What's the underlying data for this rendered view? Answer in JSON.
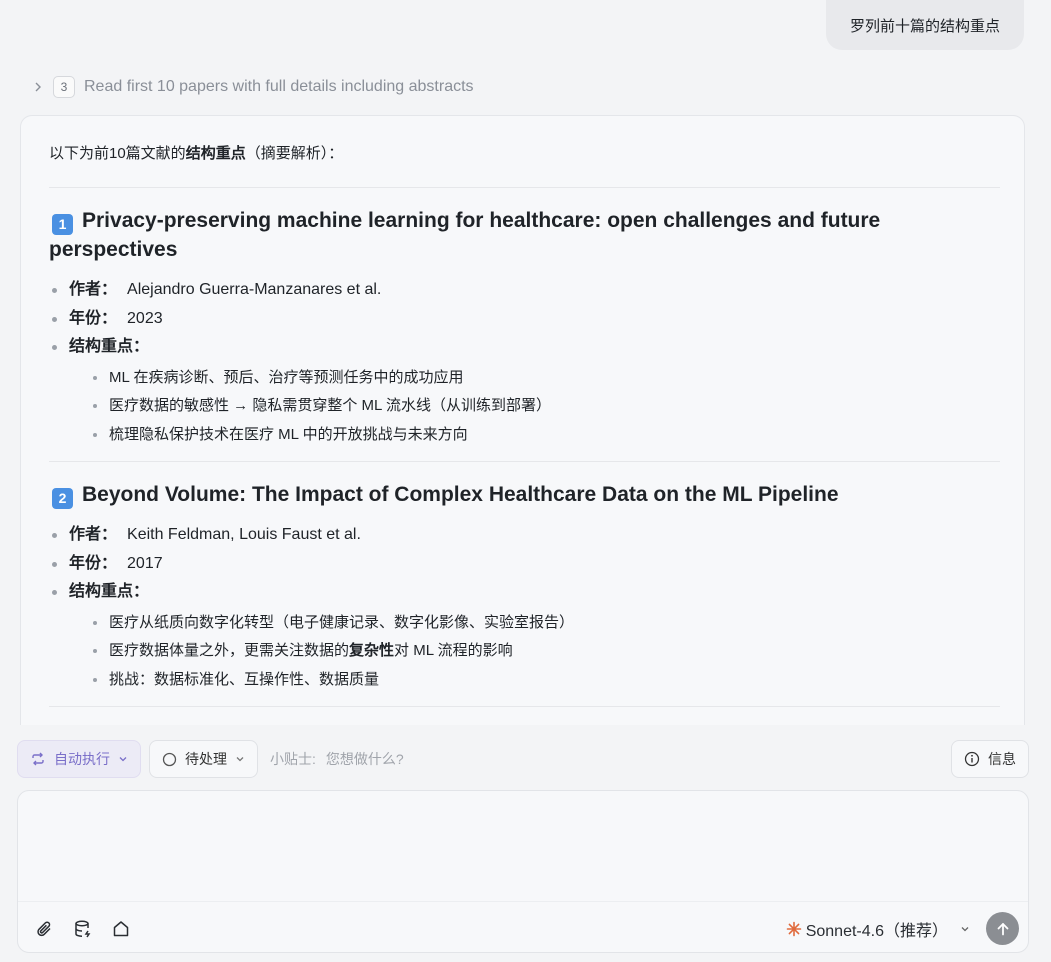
{
  "user_message": "罗列前十篇的结构重点",
  "step": {
    "number": "3",
    "label": "Read first 10 papers with full details including abstracts"
  },
  "response": {
    "intro_prefix": "以下为前10篇文献的",
    "intro_bold": "结构重点",
    "intro_suffix": "（摘要解析）：",
    "papers": [
      {
        "badge": "1",
        "title": "Privacy-preserving machine learning for healthcare: open challenges and future perspectives",
        "author_key": "作者：",
        "author": "Alejandro Guerra-Manzanares et al.",
        "year_key": "年份：",
        "year": "2023",
        "points_key": "结构重点：",
        "points": [
          "ML 在疾病诊断、预后、治疗等预测任务中的成功应用",
          "医疗数据的敏感性 → 隐私需贯穿整个 ML 流水线（从训练到部署）",
          "梳理隐私保护技术在医疗 ML 中的开放挑战与未来方向"
        ]
      },
      {
        "badge": "2",
        "title": "Beyond Volume: The Impact of Complex Healthcare Data on the ML Pipeline",
        "author_key": "作者：",
        "author": "Keith Feldman, Louis Faust et al.",
        "year_key": "年份：",
        "year": "2017",
        "points_key": "结构重点：",
        "point1": "医疗从纸质向数字化转型（电子健康记录、数字化影像、实验室报告）",
        "point2_prefix": "医疗数据体量之外，更需关注数据的",
        "point2_bold": "复杂性",
        "point2_suffix": "对 ML 流程的影响",
        "point3": "挑战：数据标准化、互操作性、数据质量"
      }
    ]
  },
  "toolbar": {
    "auto_label": "自动执行",
    "pending_label": "待处理",
    "tip_label": "小贴士:",
    "tip_text": "您想做什么?",
    "info_label": "信息"
  },
  "composer": {
    "placeholder": "",
    "model_label": "Sonnet-4.6（推荐）"
  },
  "colors": {
    "badge_blue": "#4a90e2",
    "auto_accent": "#7a6fc9",
    "model_star": "#e06a3c",
    "send_bg": "#8b8e93"
  }
}
